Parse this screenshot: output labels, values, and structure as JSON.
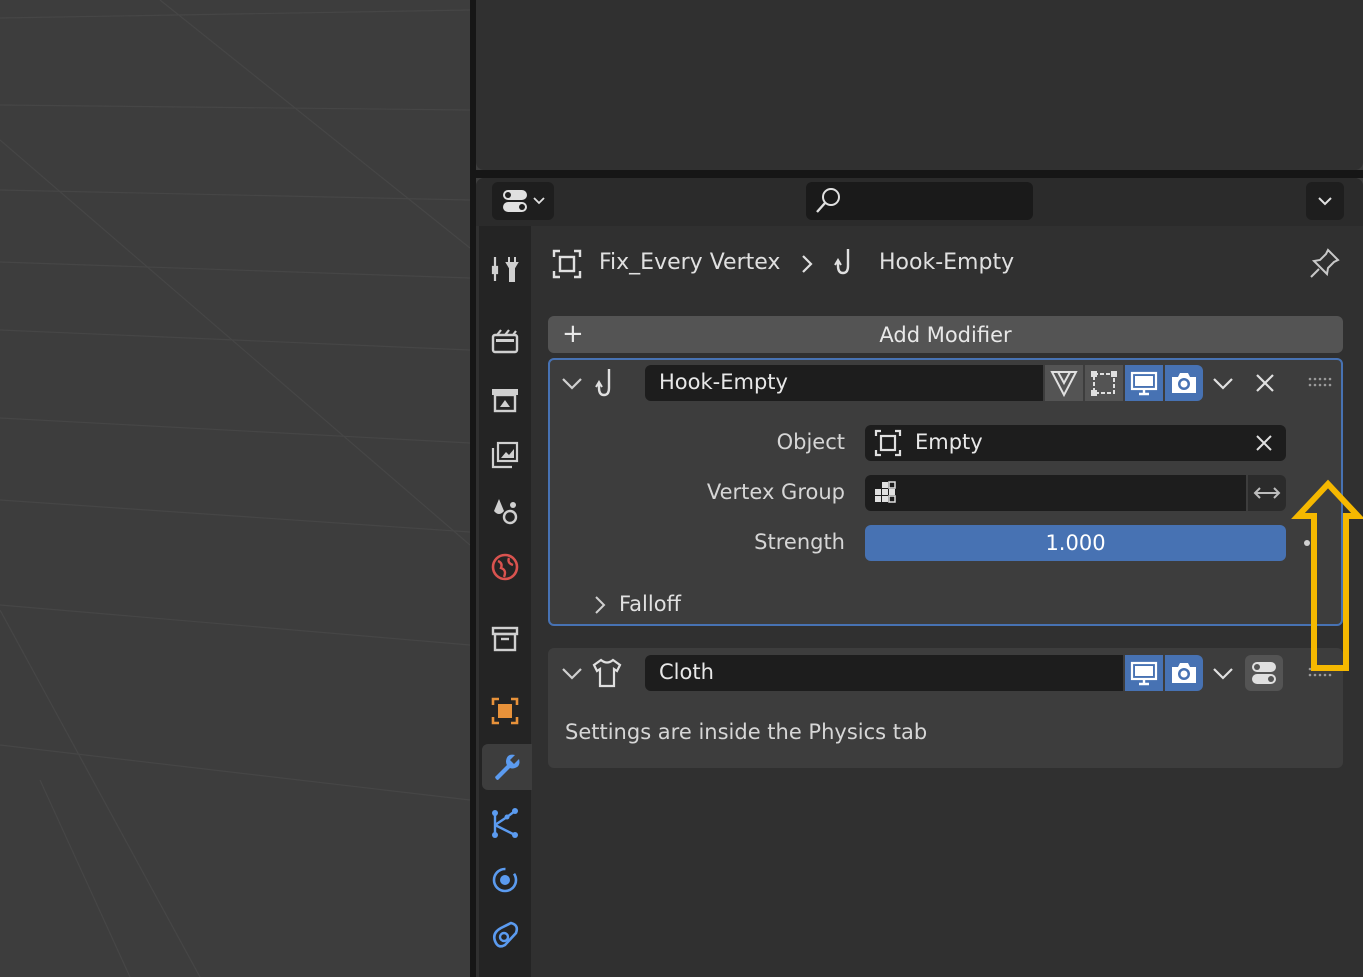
{
  "breadcrumb": {
    "object_name": "Fix_Every Vertex",
    "separator": ">",
    "modifier_name": "Hook-Empty"
  },
  "toolbar": {
    "add_modifier_plus": "+",
    "add_modifier_label": "Add Modifier"
  },
  "search": {
    "placeholder": ""
  },
  "hook_modifier": {
    "name": "Hook-Empty",
    "object_label": "Object",
    "object_value": "Empty",
    "vertex_group_label": "Vertex Group",
    "vertex_group_value": "",
    "strength_label": "Strength",
    "strength_value": "1.000",
    "falloff_label": "Falloff"
  },
  "cloth_modifier": {
    "name": "Cloth",
    "info_text": "Settings are inside the Physics tab"
  },
  "tabs": [
    "tool",
    "render",
    "output",
    "view-layer",
    "scene",
    "world",
    "collection",
    "object",
    "modifiers",
    "particles",
    "physics",
    "constraints"
  ],
  "active_tab": "modifiers",
  "colors": {
    "accent_blue": "#4772b3",
    "annotation_arrow": "#f5b800",
    "object_orange": "#e8923a",
    "world_red": "#d9534f",
    "modifier_blue": "#5b9bf0"
  }
}
